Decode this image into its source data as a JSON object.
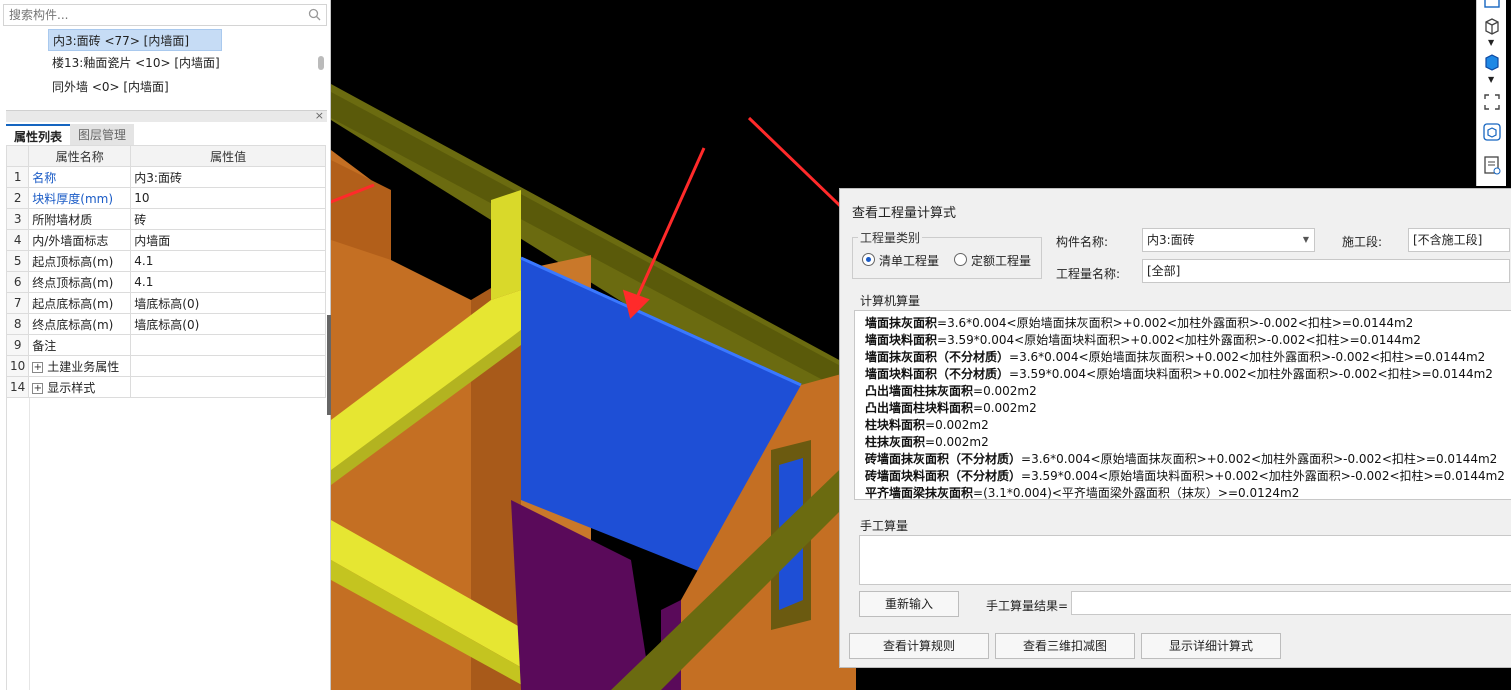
{
  "search": {
    "placeholder": "搜索构件..."
  },
  "tree": {
    "items": [
      {
        "label": "内3:面砖 <77> [内墙面]",
        "selected": true
      },
      {
        "label": "楼13:釉面瓷片 <10> [内墙面]",
        "selected": false
      },
      {
        "label": "同外墙 <0> [内墙面]",
        "selected": false
      }
    ]
  },
  "tabs": {
    "properties": "属性列表",
    "layers": "图层管理"
  },
  "props": {
    "header_name": "属性名称",
    "header_value": "属性值",
    "rows": [
      {
        "num": "1",
        "name": "名称",
        "value": "内3:面砖"
      },
      {
        "num": "2",
        "name": "块料厚度(mm)",
        "value": "10"
      },
      {
        "num": "3",
        "name": "所附墙材质",
        "value": "砖"
      },
      {
        "num": "4",
        "name": "内/外墙面标志",
        "value": "内墙面"
      },
      {
        "num": "5",
        "name": "起点顶标高(m)",
        "value": "4.1"
      },
      {
        "num": "6",
        "name": "终点顶标高(m)",
        "value": "4.1"
      },
      {
        "num": "7",
        "name": "起点底标高(m)",
        "value": "墙底标高(0)"
      },
      {
        "num": "8",
        "name": "终点底标高(m)",
        "value": "墙底标高(0)"
      },
      {
        "num": "9",
        "name": "备注",
        "value": ""
      },
      {
        "num": "10",
        "name": "土建业务属性",
        "value": ""
      },
      {
        "num": "14",
        "name": "显示样式",
        "value": ""
      }
    ]
  },
  "dialog": {
    "title": "查看工程量计算式",
    "quantity_type_label": "工程量类别",
    "radio_bill": "清单工程量",
    "radio_quota": "定额工程量",
    "component_name_label": "构件名称:",
    "component_name_value": "内3:面砖",
    "stage_label": "施工段:",
    "stage_value": "[不含施工段]",
    "quantity_name_label": "工程量名称:",
    "quantity_name_value": "[全部]",
    "computer_calc_label": "计算机算量",
    "calc_lines": [
      {
        "name": "墙面抹灰面积",
        "formula": "=3.6*0.004<原始墙面抹灰面积>+0.002<加柱外露面积>-0.002<扣柱>=0.0144m2"
      },
      {
        "name": "墙面块料面积",
        "formula": "=3.59*0.004<原始墙面块料面积>+0.002<加柱外露面积>-0.002<扣柱>=0.0144m2"
      },
      {
        "name": "墙面抹灰面积（不分材质）",
        "formula": "=3.6*0.004<原始墙面抹灰面积>+0.002<加柱外露面积>-0.002<扣柱>=0.0144m2"
      },
      {
        "name": "墙面块料面积（不分材质）",
        "formula": "=3.59*0.004<原始墙面块料面积>+0.002<加柱外露面积>-0.002<扣柱>=0.0144m2"
      },
      {
        "name": "凸出墙面柱抹灰面积",
        "formula": "=0.002m2"
      },
      {
        "name": "凸出墙面柱块料面积",
        "formula": "=0.002m2"
      },
      {
        "name": "柱块料面积",
        "formula": "=0.002m2"
      },
      {
        "name": "柱抹灰面积",
        "formula": "=0.002m2"
      },
      {
        "name": "砖墙面抹灰面积（不分材质）",
        "formula": "=3.6*0.004<原始墙面抹灰面积>+0.002<加柱外露面积>-0.002<扣柱>=0.0144m2"
      },
      {
        "name": "砖墙面块料面积（不分材质）",
        "formula": "=3.59*0.004<原始墙面块料面积>+0.002<加柱外露面积>-0.002<扣柱>=0.0144m2"
      },
      {
        "name": "平齐墙面梁抹灰面积",
        "formula": "=(3.1*0.004)<平齐墙面梁外露面积（抹灰）>=0.0124m2"
      }
    ],
    "manual_calc_label": "手工算量",
    "reenter_button": "重新输入",
    "manual_result_label": "手工算量结果=",
    "btn_view_rules": "查看计算规则",
    "btn_view_3d": "查看三维扣减图",
    "btn_show_detail": "显示详细计算式"
  }
}
